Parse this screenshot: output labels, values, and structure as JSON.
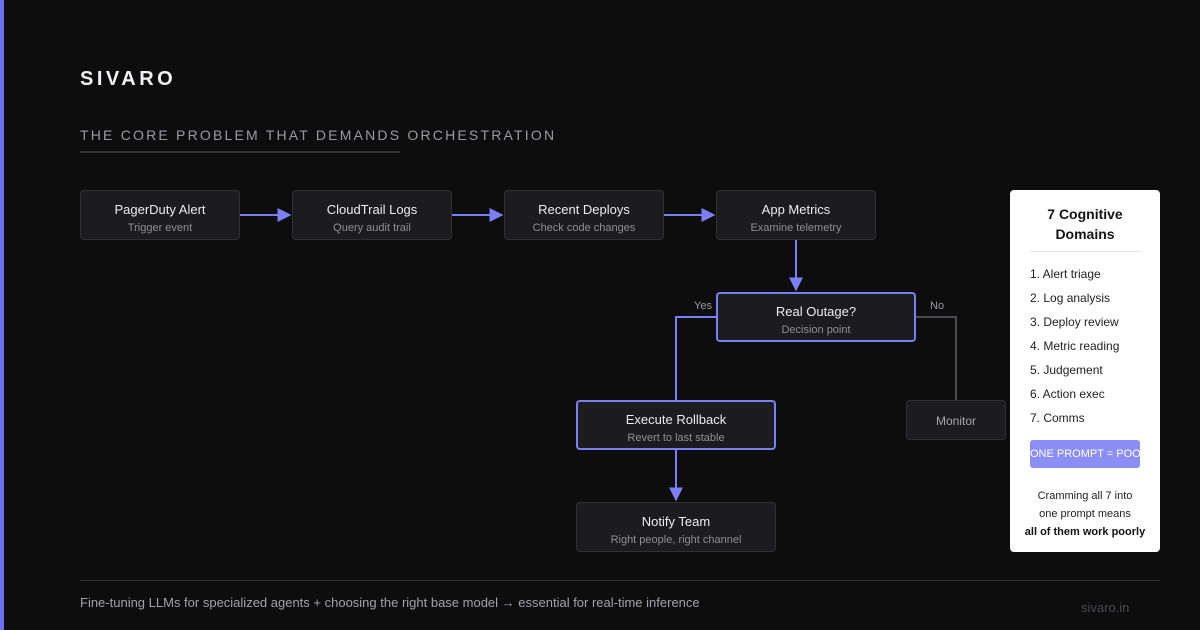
{
  "brand": "SIVARO",
  "subtitle": "THE CORE PROBLEM THAT DEMANDS ORCHESTRATION",
  "flow": {
    "nodes": [
      {
        "id": "pagerduty",
        "title": "PagerDuty Alert",
        "sub": "Trigger event"
      },
      {
        "id": "cloudtrail",
        "title": "CloudTrail Logs",
        "sub": "Query audit trail"
      },
      {
        "id": "deploys",
        "title": "Recent Deploys",
        "sub": "Check code changes"
      },
      {
        "id": "metrics",
        "title": "App Metrics",
        "sub": "Examine telemetry"
      },
      {
        "id": "outage",
        "title": "Real Outage?",
        "sub": "Decision point"
      },
      {
        "id": "rollback",
        "title": "Execute Rollback",
        "sub": "Revert to last stable"
      },
      {
        "id": "notify",
        "title": "Notify Team",
        "sub": "Right people, right channel"
      },
      {
        "id": "monitor",
        "title": "Monitor"
      }
    ],
    "edges": [
      {
        "from": "pagerduty",
        "to": "cloudtrail"
      },
      {
        "from": "cloudtrail",
        "to": "deploys"
      },
      {
        "from": "deploys",
        "to": "metrics"
      },
      {
        "from": "metrics",
        "to": "outage"
      },
      {
        "from": "outage",
        "to": "rollback",
        "label": "Yes"
      },
      {
        "from": "rollback",
        "to": "notify"
      },
      {
        "from": "outage",
        "to": "monitor",
        "label": "No"
      }
    ],
    "yes_label": "Yes",
    "no_label": "No"
  },
  "panel": {
    "title_line1": "7 Cognitive",
    "title_line2": "Domains",
    "items": [
      "1. Alert triage",
      "2. Log analysis",
      "3. Deploy review",
      "4. Metric reading",
      "5. Judgement",
      "6. Action exec",
      "7. Comms"
    ],
    "badge": "ONE PROMPT = POOR",
    "note_line1": "Cramming all 7 into",
    "note_line2": "one prompt means",
    "note_strong": "all of them work poorly"
  },
  "footer": {
    "text": "Fine-tuning LLMs for specialized agents + choosing the right base model → essential for real-time inference",
    "url": "sivaro.in"
  },
  "colors": {
    "background": "#0d0d0e",
    "accent": "#7b7ff5",
    "node_fill": "#1c1c1f",
    "panel_bg": "#ffffff",
    "badge": "#8b8ef5"
  }
}
